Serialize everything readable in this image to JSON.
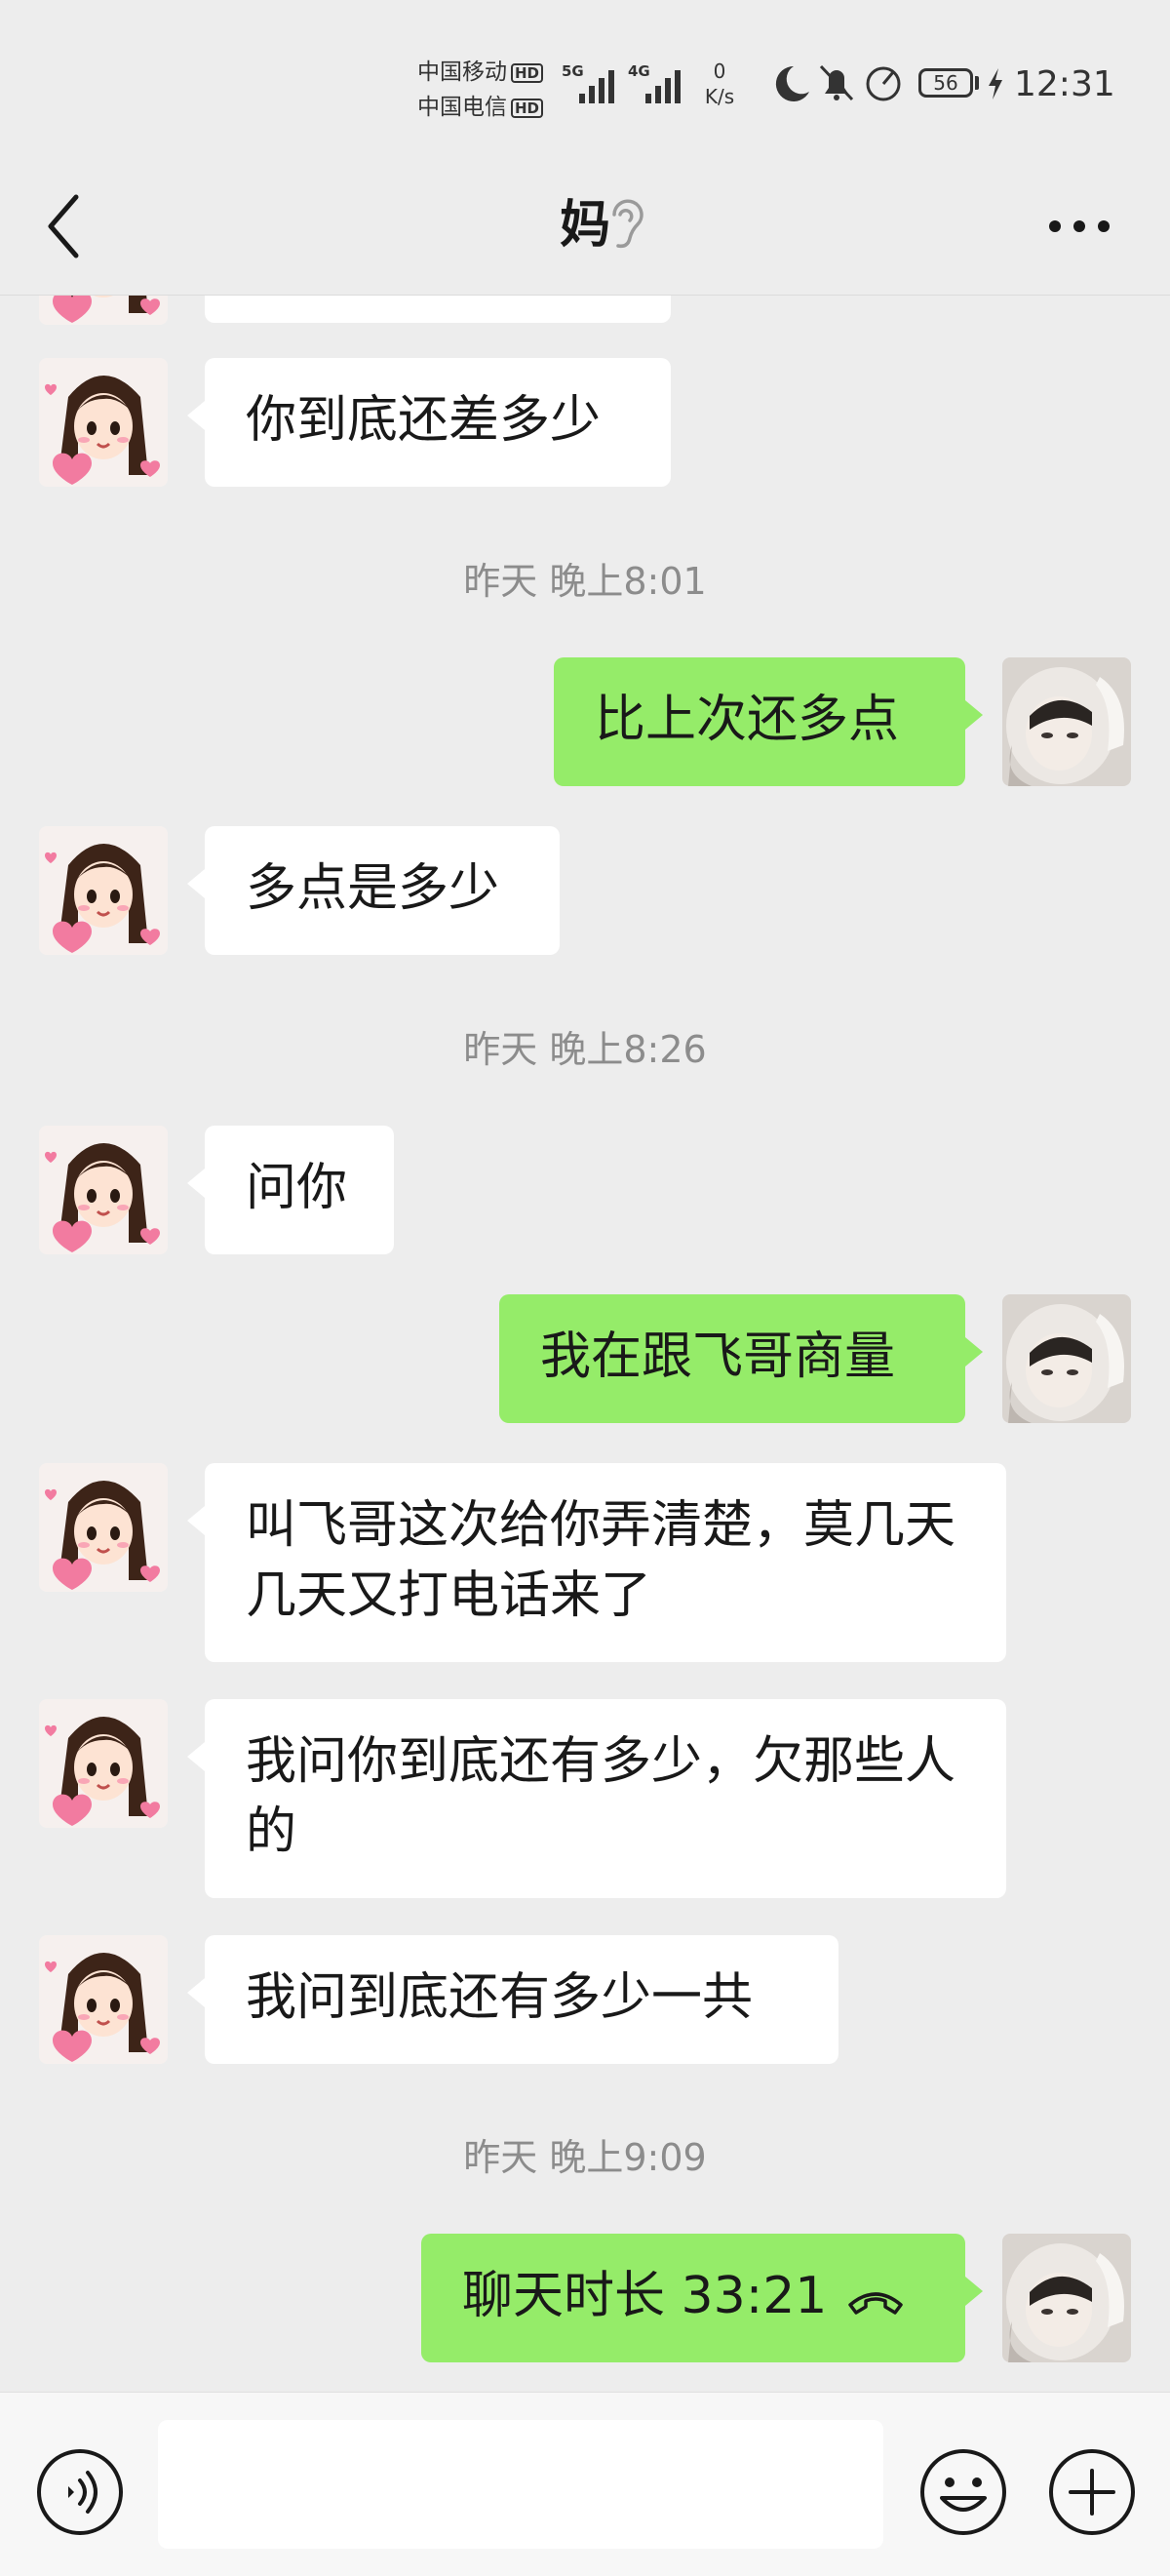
{
  "status_bar": {
    "carrier_1": "中国移动",
    "carrier_2": "中国电信",
    "hd_label": "HD",
    "sig1_label": "5G",
    "sig2_label": "4G",
    "net_speed_value": "0",
    "net_speed_unit": "K/s",
    "battery": "56",
    "time": "12:31"
  },
  "header": {
    "title": "妈"
  },
  "messages": [
    {
      "side": "in",
      "text": ""
    },
    {
      "side": "in",
      "text": "你到底还差多少"
    },
    {
      "type": "timestamp",
      "text": "昨天 晚上8:01"
    },
    {
      "side": "out",
      "text": "比上次还多点"
    },
    {
      "side": "in",
      "text": "多点是多少"
    },
    {
      "type": "timestamp",
      "text": "昨天 晚上8:26"
    },
    {
      "side": "in",
      "text": "问你"
    },
    {
      "side": "out",
      "text": "我在跟飞哥商量"
    },
    {
      "side": "in",
      "text": "叫飞哥这次给你弄清楚，莫几天几天又打电话来了"
    },
    {
      "side": "in",
      "text": "我问你到底还有多少，欠那些人的"
    },
    {
      "side": "in",
      "text": "我问到底还有多少一共"
    },
    {
      "type": "timestamp",
      "text": "昨天 晚上9:09"
    },
    {
      "side": "out",
      "text": "聊天时长 33:21",
      "icon": "phone-hangup-icon"
    }
  ],
  "input_bar": {
    "value": ""
  },
  "colors": {
    "background": "#ededed",
    "bubble_in": "#ffffff",
    "bubble_out": "#95ec69",
    "timestamp": "#8c8c8c"
  }
}
